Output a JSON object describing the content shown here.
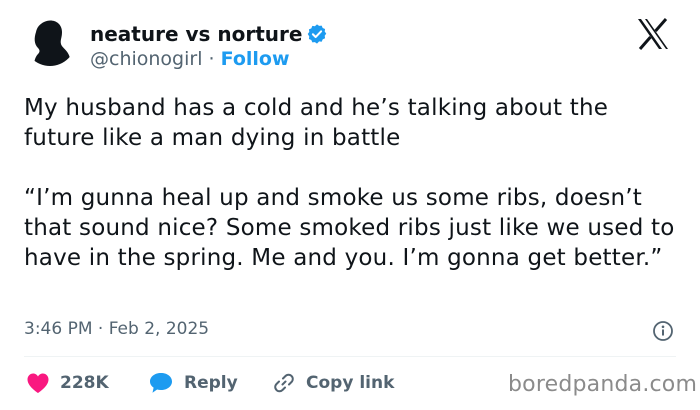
{
  "author": {
    "display_name": "neature vs norture",
    "handle": "@chionogirl",
    "separator": "·",
    "follow_label": "Follow",
    "verified": true
  },
  "tweet": {
    "paragraphs": [
      "My husband has a cold and he’s talking about the future like a man dying in battle",
      "“I’m gunna heal up and smoke us some ribs, doesn’t that sound nice? Some smoked ribs just like we used to have in the spring. Me and you. I’m gonna get better.”"
    ],
    "timestamp": "3:46 PM · Feb 2, 2025"
  },
  "actions": {
    "like_count": "228K",
    "reply_label": "Reply",
    "copy_link_label": "Copy link"
  },
  "watermark": "boredpanda.com",
  "icons": {
    "avatar": "silhouette-avatar",
    "verified": "verified-badge-icon",
    "logo": "x-logo-icon",
    "info": "info-icon",
    "like": "heart-icon",
    "reply": "speech-bubble-icon",
    "copy": "link-icon"
  },
  "colors": {
    "text": "#0f1419",
    "secondary": "#536471",
    "accent": "#1d9bf0",
    "like": "#f91880",
    "watermark": "#8b8b8b"
  }
}
